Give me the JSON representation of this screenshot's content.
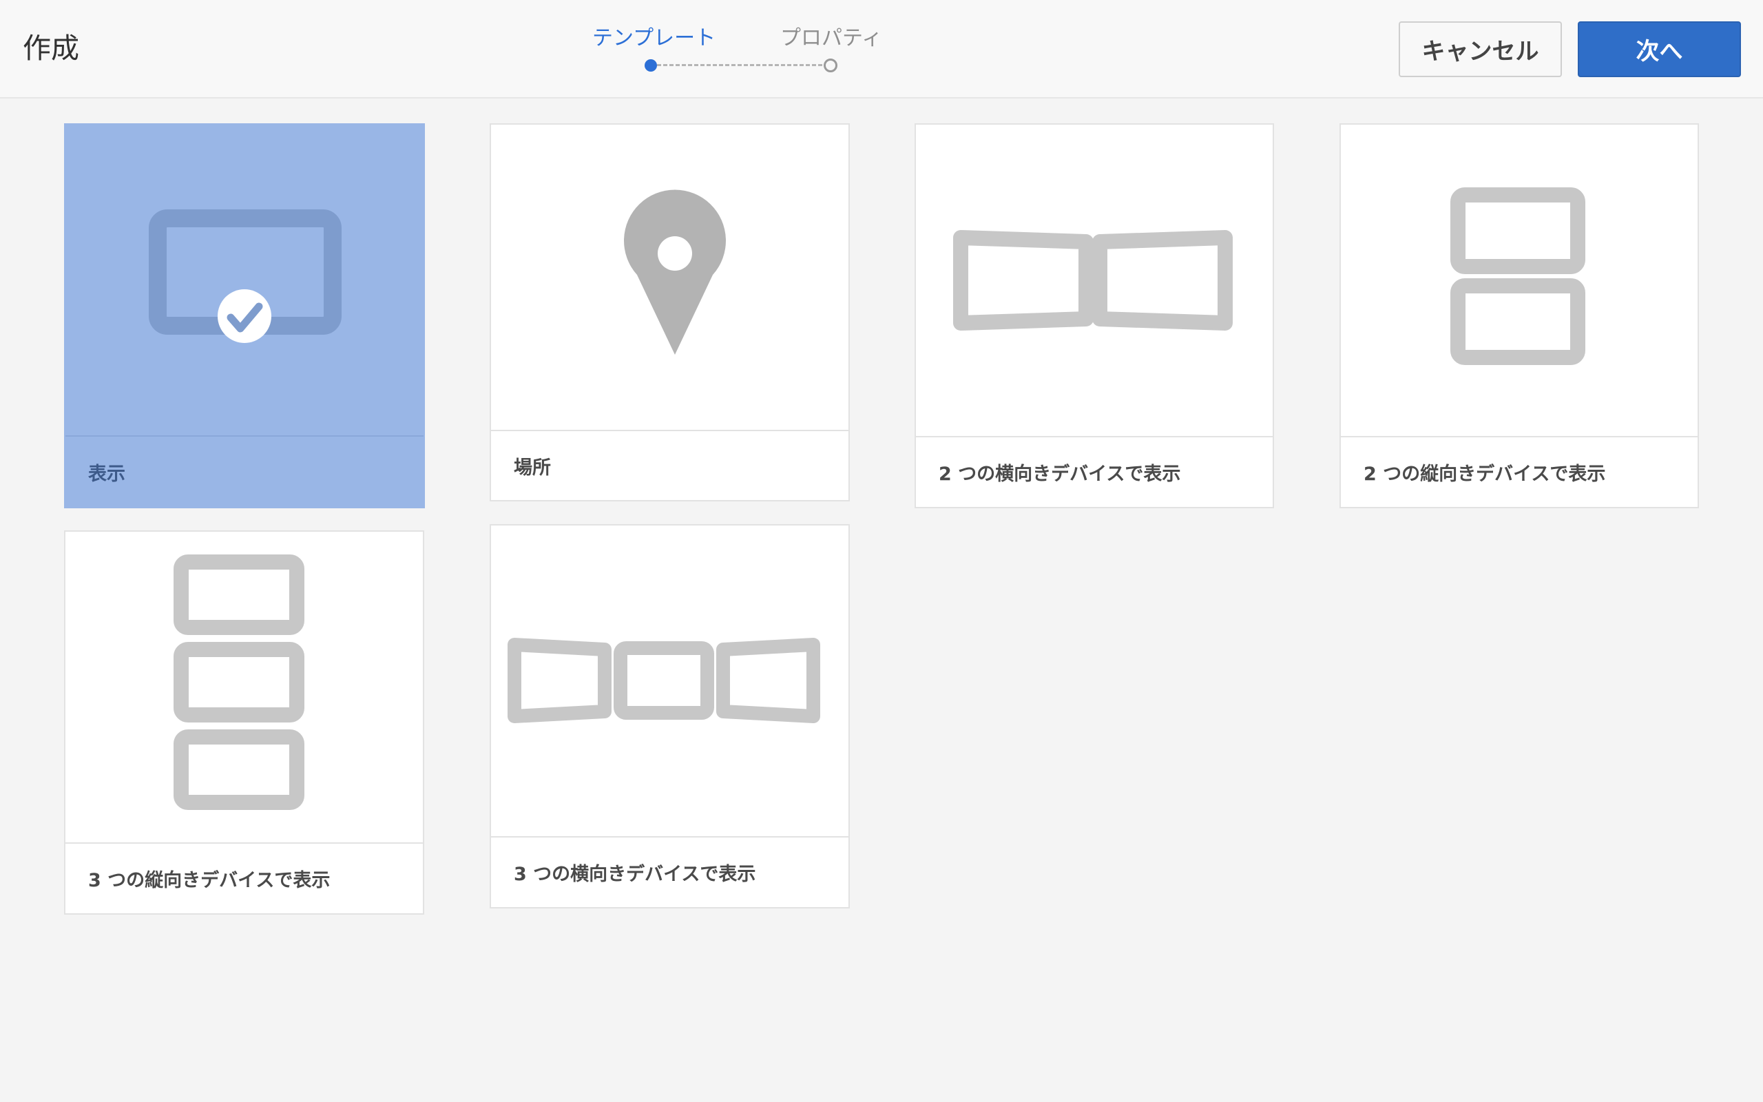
{
  "header": {
    "title": "作成",
    "steps": [
      {
        "label": "テンプレート",
        "state": "active"
      },
      {
        "label": "プロパティ",
        "state": "inactive"
      }
    ],
    "cancel_label": "キャンセル",
    "next_label": "次へ"
  },
  "templates": [
    {
      "label": "表示",
      "icon": "display-icon",
      "selected": true
    },
    {
      "label": "場所",
      "icon": "location-pin-icon",
      "selected": false
    },
    {
      "label": "2 つの横向きデバイスで表示",
      "icon": "two-landscape-devices-icon",
      "selected": false
    },
    {
      "label": "2 つの縦向きデバイスで表示",
      "icon": "two-portrait-devices-icon",
      "selected": false
    },
    {
      "label": "3 つの縦向きデバイスで表示",
      "icon": "three-portrait-devices-icon",
      "selected": false
    },
    {
      "label": "3 つの横向きデバイスで表示",
      "icon": "three-landscape-devices-icon",
      "selected": false
    }
  ],
  "colors": {
    "accent": "#2f6ec8",
    "selected_card": "#99b6e6",
    "icon_gray": "#c7c7c7"
  }
}
